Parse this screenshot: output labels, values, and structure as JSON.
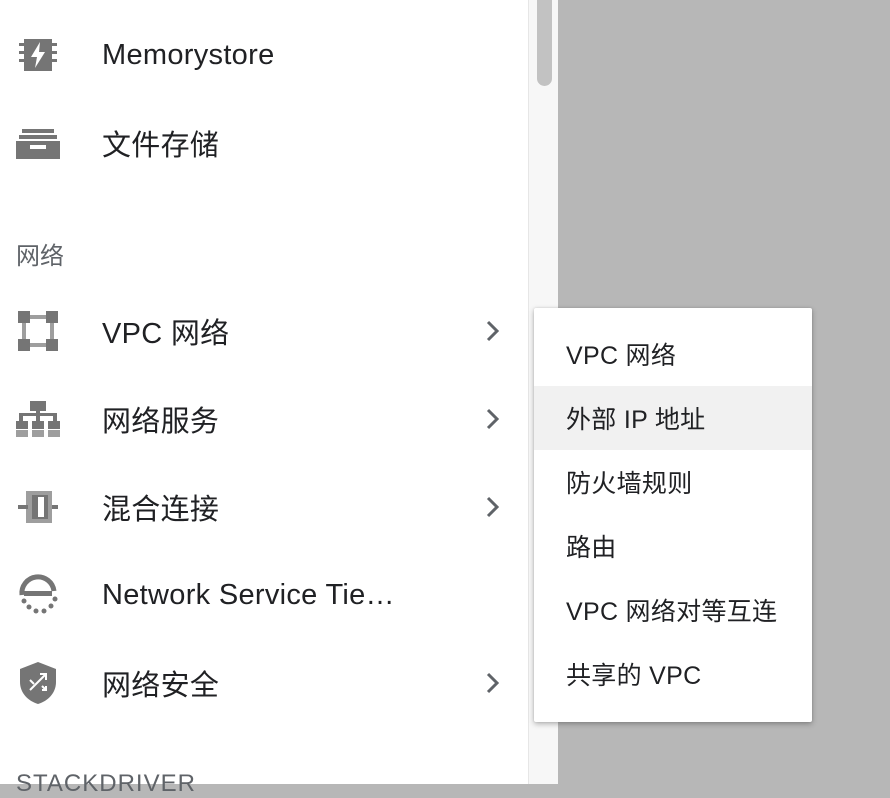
{
  "nav": {
    "items": [
      {
        "label": "Memorystore",
        "icon": "memorystore-icon",
        "has_submenu": false
      },
      {
        "label": "文件存储",
        "icon": "filestore-icon",
        "has_submenu": false
      }
    ],
    "network_section": {
      "header": "网络",
      "items": [
        {
          "label": "VPC 网络",
          "icon": "vpc-network-icon",
          "has_submenu": true
        },
        {
          "label": "网络服务",
          "icon": "network-services-icon",
          "has_submenu": true
        },
        {
          "label": "混合连接",
          "icon": "hybrid-connectivity-icon",
          "has_submenu": true
        },
        {
          "label": "Network Service Tie…",
          "icon": "network-service-tiers-icon",
          "has_submenu": false
        },
        {
          "label": "网络安全",
          "icon": "network-security-icon",
          "has_submenu": true
        }
      ]
    },
    "next_section_header": "STACKDRIVER"
  },
  "submenu": {
    "items": [
      {
        "label": "VPC 网络"
      },
      {
        "label": "外部 IP 地址",
        "hovered": true
      },
      {
        "label": "防火墙规则"
      },
      {
        "label": "路由"
      },
      {
        "label": "VPC 网络对等互连"
      },
      {
        "label": "共享的 VPC"
      }
    ]
  },
  "colors": {
    "icon_gray": "#757575",
    "overlay": "#b7b7b7",
    "text": "#202124",
    "hover_bg": "#f1f1f1"
  }
}
